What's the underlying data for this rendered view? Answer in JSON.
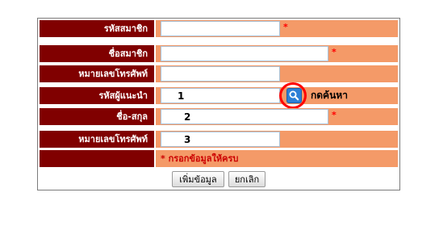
{
  "form": {
    "rows": [
      {
        "label": "รหัสสมาชิก",
        "value": "",
        "required": "*"
      },
      {
        "label": "ชื่อสมาชิก",
        "value": "",
        "required": "*"
      },
      {
        "label": "หมายเลขโทรศัพท์",
        "value": ""
      },
      {
        "label": "รหัสผู้แนะนำ",
        "value": "1",
        "search_label": "กดค้นหา"
      },
      {
        "label": "ชื่อ-สกุล",
        "value": "2",
        "required": "*"
      },
      {
        "label": "หมายเลขโทรศัพท์",
        "value": "3"
      }
    ],
    "note": "* กรอกข้อมูลให้ครบ",
    "buttons": {
      "submit": "เพิ่มข้อมูล",
      "cancel": "ยกเลิก"
    }
  },
  "colors": {
    "label_bg": "#800000",
    "value_bg": "#f49a68",
    "highlight_circle": "#ff0000",
    "search_icon": "#2c7fd6"
  }
}
